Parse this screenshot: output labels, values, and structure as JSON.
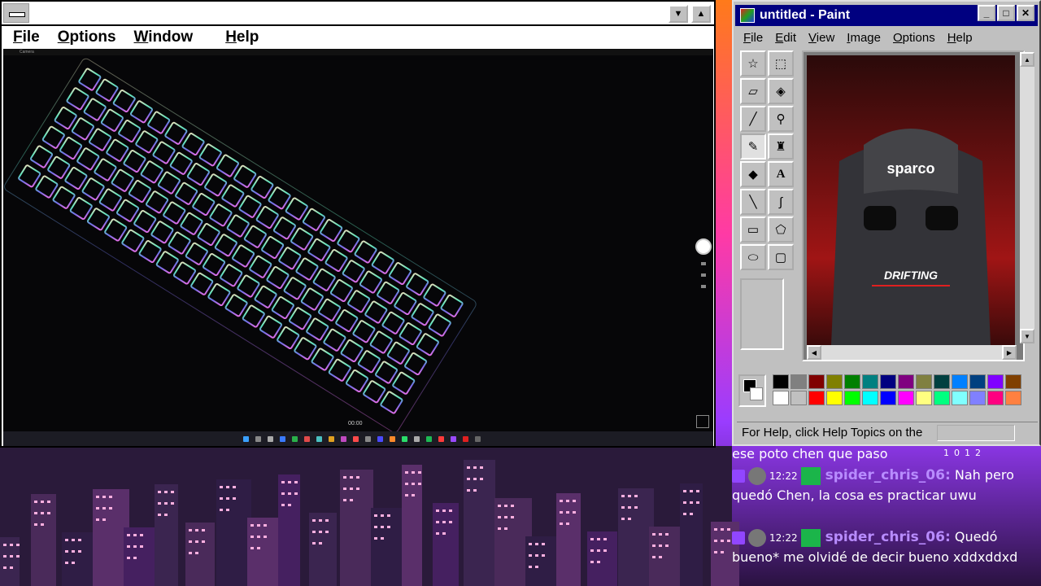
{
  "camera_window": {
    "menu": [
      "File",
      "Options",
      "Window",
      "Help"
    ],
    "caption": "Camera",
    "timecode": "00:00"
  },
  "paint": {
    "title": "untitled - Paint",
    "menu": [
      "File",
      "Edit",
      "View",
      "Image",
      "Options",
      "Help"
    ],
    "status": "For Help, click Help Topics on the",
    "tools": [
      "free-select",
      "rect-select",
      "eraser",
      "fill",
      "eyedropper",
      "magnifier",
      "pencil",
      "brush",
      "airbrush",
      "text",
      "line",
      "curve",
      "rectangle",
      "polygon",
      "ellipse",
      "rounded-rect"
    ],
    "palette_top": [
      "#000000",
      "#808080",
      "#800000",
      "#808000",
      "#008000",
      "#008080",
      "#000080",
      "#800080",
      "#808040",
      "#004040",
      "#0080ff",
      "#004080",
      "#8000ff",
      "#804000"
    ],
    "palette_bottom": [
      "#ffffff",
      "#c0c0c0",
      "#ff0000",
      "#ffff00",
      "#00ff00",
      "#00ffff",
      "#0000ff",
      "#ff00ff",
      "#ffff80",
      "#00ff80",
      "#80ffff",
      "#8080ff",
      "#ff0080",
      "#ff8040"
    ],
    "canvas_brand": "sparco",
    "canvas_text": "DRIFTING"
  },
  "chat": {
    "partial": "ese poto chen que paso",
    "counters": [
      "1",
      "0",
      "1",
      "2"
    ],
    "messages": [
      {
        "time": "12:22",
        "user": "spider_chris_06:",
        "text": "Nah pero quedó Chen, la cosa es practicar uwu"
      },
      {
        "time": "12:22",
        "user": "spider_chris_06:",
        "text": "Quedó bueno* me olvidé de decir bueno xddxddxd"
      }
    ]
  }
}
